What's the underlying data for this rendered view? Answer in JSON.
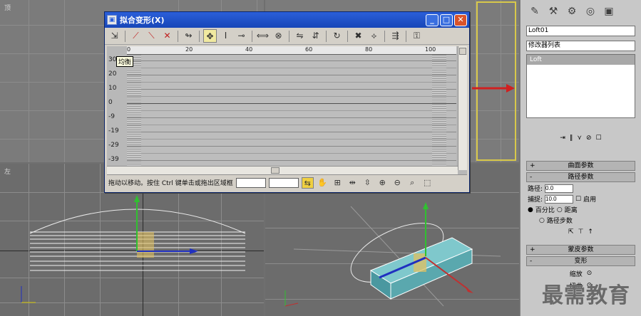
{
  "dialog": {
    "title": "拟合变形(X)",
    "minimize": "_",
    "maximize": "□",
    "close": "✕",
    "tooltip": "均衡",
    "ruler_ticks": [
      "0",
      "20",
      "40",
      "60",
      "80",
      "100"
    ],
    "y_labels": [
      "30",
      "20",
      "10",
      "0",
      "-9",
      "-19",
      "-29",
      "-39"
    ],
    "status_text": "拖动以移动。按住 Ctrl 键单击或拖出区域框"
  },
  "toolbar_icons": [
    "curve-icon",
    "arrow-icon",
    "delete-icon",
    "move-icon",
    "scale-icon",
    "insert-icon",
    "reset-icon",
    "flip-icon",
    "mirror-icon",
    "lock-icon",
    "x-icon",
    "get-shape-icon"
  ],
  "panel": {
    "object_name": "Loft01",
    "modifier_list": "修改器列表",
    "stack_item": "Loft",
    "rollout_surface": "曲面参数",
    "rollout_path": "路径参数",
    "path_label": "路径:",
    "path_value": "0.0",
    "snap_label": "捕捉:",
    "snap_value": "10.0",
    "enable_label": "启用",
    "percent_label": "百分比",
    "distance_label": "距离",
    "path_steps_label": "路径步数",
    "rollout_skin": "蒙皮参数",
    "rollout_deform": "变形",
    "scale_label": "缩放",
    "twist_label": "扭曲",
    "minus": "-",
    "plus": "+"
  },
  "watermark": "最需教育"
}
